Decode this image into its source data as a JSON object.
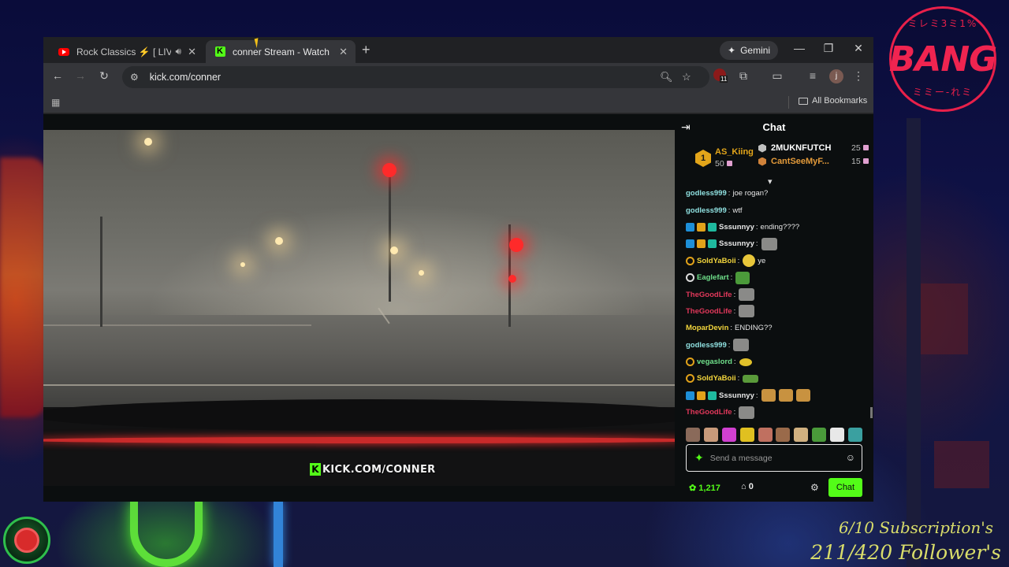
{
  "overlay": {
    "logo_word": "BANG",
    "logo_arc_top": "ミレミ3ミ1%",
    "logo_arc_bottom": "ミミー-れミ",
    "subs_text": "6/10 Subscription's",
    "follows_text": "211/420 Follower's"
  },
  "browser": {
    "tabs": [
      {
        "title": "Rock Classics ⚡ [ LIVE ] Ti",
        "favicon": "youtube-icon",
        "audio": true
      },
      {
        "title": "conner Stream - Watch Live on",
        "favicon": "kick-icon",
        "active": true
      }
    ],
    "gemini_label": "Gemini",
    "url": "kick.com/conner",
    "extension_badge_count": "11",
    "profile_initial": "j",
    "all_bookmarks_label": "All Bookmarks"
  },
  "video": {
    "watermark_text": "KICK.COM/CONNER"
  },
  "chat": {
    "title": "Chat",
    "leaderboard": {
      "first": {
        "rank": "1",
        "name": "AS_Kiing",
        "value": "50"
      },
      "second": {
        "name": "2MUKNFUTCH",
        "value": "25"
      },
      "third": {
        "name": "CantSeeMyF...",
        "value": "15"
      }
    },
    "messages": [
      {
        "user": "godless999",
        "color": "#8fe0e0",
        "badges": [],
        "text": "joe rogan?",
        "emotes": []
      },
      {
        "user": "godless999",
        "color": "#8fe0e0",
        "badges": [],
        "text": "wtf",
        "emotes": []
      },
      {
        "user": "Sssunnyy",
        "color": "#e8e8e8",
        "badges": [
          "blue",
          "gold",
          "teal"
        ],
        "text": "ending????",
        "emotes": []
      },
      {
        "user": "Sssunnyy",
        "color": "#e8e8e8",
        "badges": [
          "blue",
          "gold",
          "teal"
        ],
        "text": "",
        "emotes": [
          "cat"
        ]
      },
      {
        "user": "SoldYaBoii",
        "color": "#f2d53c",
        "badges": [
          "circ"
        ],
        "text": "ye",
        "emotes": [
          "lol"
        ]
      },
      {
        "user": "Eaglefart",
        "color": "#6fe08a",
        "badges": [
          "circ-white"
        ],
        "text": "",
        "emotes": [
          "frog"
        ]
      },
      {
        "user": "TheGoodLife",
        "color": "#e0385a",
        "badges": [],
        "text": "",
        "emotes": [
          "cat"
        ]
      },
      {
        "user": "TheGoodLife",
        "color": "#e0385a",
        "badges": [],
        "text": "",
        "emotes": [
          "cat"
        ]
      },
      {
        "user": "MoparDevin",
        "color": "#f2d53c",
        "badges": [],
        "text": "ENDING??",
        "emotes": []
      },
      {
        "user": "godless999",
        "color": "#8fe0e0",
        "badges": [],
        "text": "",
        "emotes": [
          "cat"
        ]
      },
      {
        "user": "vegaslord",
        "color": "#6fe08a",
        "badges": [
          "circ"
        ],
        "text": "",
        "emotes": [
          "small"
        ]
      },
      {
        "user": "SoldYaBoii",
        "color": "#f2d53c",
        "badges": [
          "circ"
        ],
        "text": "",
        "emotes": [
          "frog2"
        ]
      },
      {
        "user": "Sssunnyy",
        "color": "#e8e8e8",
        "badges": [
          "blue",
          "gold",
          "teal"
        ],
        "text": "",
        "emotes": [
          "hand",
          "hand",
          "hand"
        ]
      },
      {
        "user": "TheGoodLife",
        "color": "#e0385a",
        "badges": [],
        "text": "",
        "emotes": [
          "cat"
        ]
      }
    ],
    "input_placeholder": "Send a message",
    "points": "1,217",
    "store_count": "0",
    "send_label": "Chat"
  }
}
